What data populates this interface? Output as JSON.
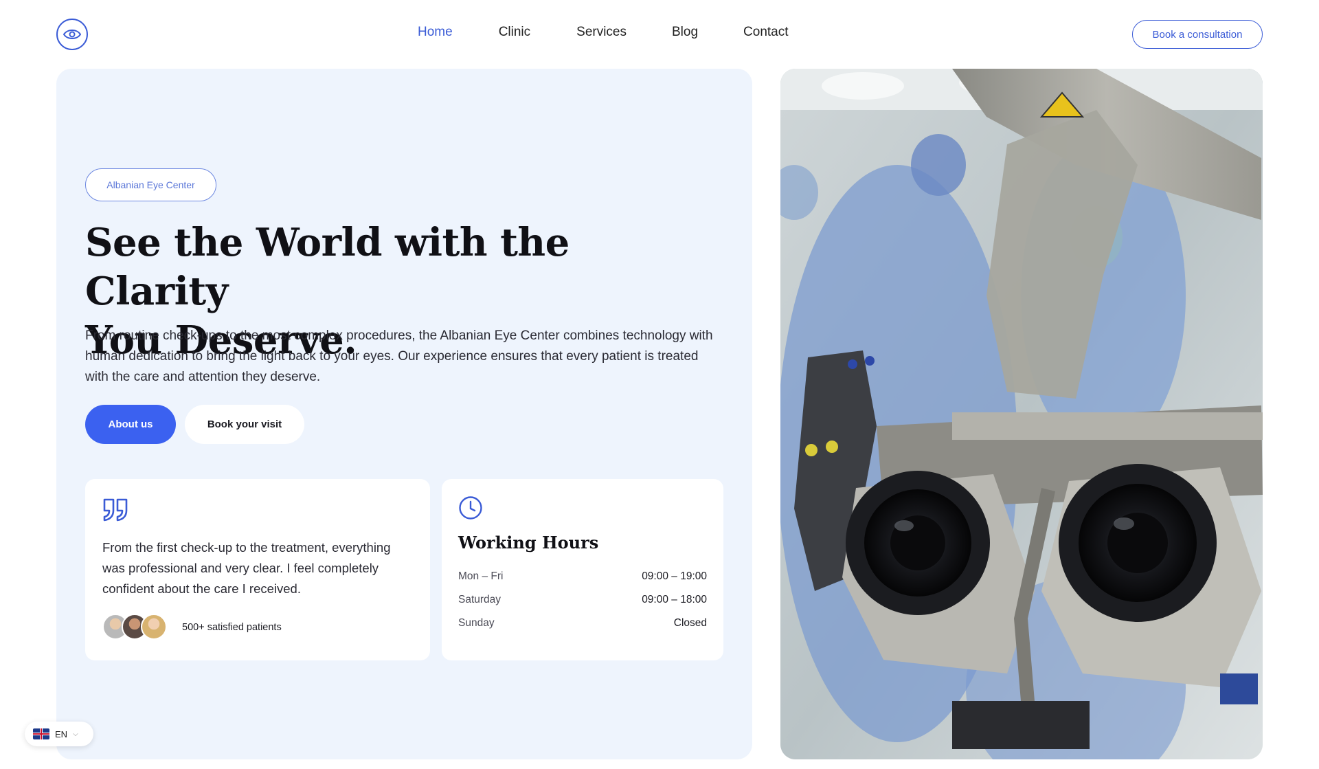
{
  "header": {
    "nav": [
      {
        "label": "Home",
        "active": true
      },
      {
        "label": "Clinic",
        "active": false
      },
      {
        "label": "Services",
        "active": false
      },
      {
        "label": "Blog",
        "active": false
      },
      {
        "label": "Contact",
        "active": false
      }
    ],
    "cta_label": "Book a consultation",
    "logo_icon": "eye-icon"
  },
  "hero": {
    "tagline": "Albanian Eye Center",
    "headline_line1": "See the World with the Clarity",
    "headline_line2": "You Deserve.",
    "lead": "From routine check-ups to the most complex procedures, the Albanian Eye Center combines technology with human dedication to bring the light back to your eyes. Our experience ensures that every patient is treated with the care and attention they deserve.",
    "primary_button": "About us",
    "secondary_button": "Book your visit"
  },
  "testimonial": {
    "icon": "quote-icon",
    "text": "From the first check-up to the treatment, everything was professional and very clear. I feel completely confident about the care I received.",
    "patients_label": "500+ satisfied patients"
  },
  "hours": {
    "icon": "clock-icon",
    "title": "Working Hours",
    "rows": [
      {
        "day": "Mon – Fri",
        "time": "09:00 – 19:00"
      },
      {
        "day": "Saturday",
        "time": "09:00 – 18:00"
      },
      {
        "day": "Sunday",
        "time": "Closed"
      }
    ]
  },
  "language": {
    "code": "EN",
    "flag": "uk-flag-icon"
  },
  "colors": {
    "accent": "#3b61f0",
    "nav_active": "#3a5bd6",
    "panel_bg": "#eef4fd"
  }
}
